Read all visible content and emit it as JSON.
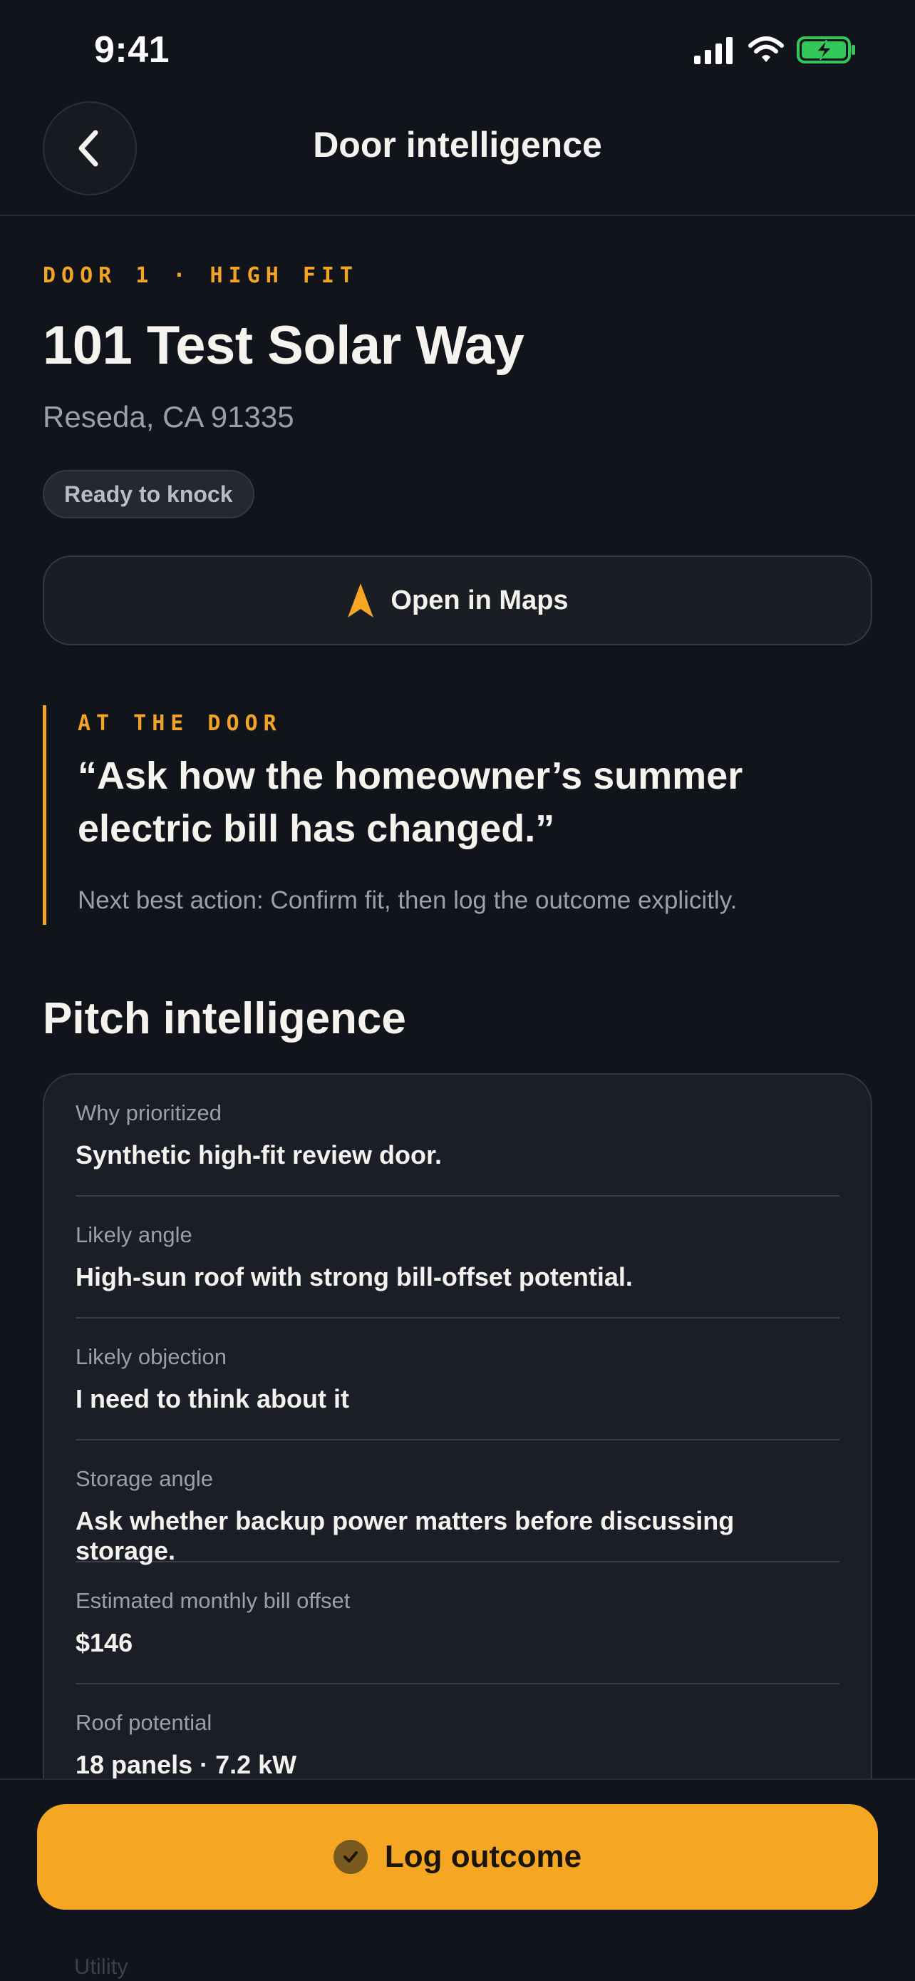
{
  "status_bar": {
    "time": "9:41",
    "icons": [
      "cellular-signal-icon",
      "wifi-icon",
      "battery-charging-icon"
    ]
  },
  "nav": {
    "title": "Door intelligence",
    "back_icon": "chevron-left-icon"
  },
  "door": {
    "eyebrow": "DOOR 1 · HIGH FIT",
    "address": "101 Test Solar Way",
    "city": "Reseda, CA 91335",
    "status": "Ready to knock"
  },
  "maps_button": {
    "label": "Open in Maps",
    "icon": "navigation-arrow-icon"
  },
  "callout": {
    "eyebrow": "AT THE DOOR",
    "quote": "“Ask how the homeowner’s summer electric bill has changed.”",
    "action": "Next best action: Confirm fit, then log the outcome explicitly."
  },
  "pitch": {
    "title": "Pitch intelligence",
    "rows": [
      {
        "label": "Why prioritized",
        "value": "Synthetic high-fit review door."
      },
      {
        "label": "Likely angle",
        "value": "High-sun roof with strong bill-offset potential."
      },
      {
        "label": "Likely objection",
        "value": "I need to think about it"
      },
      {
        "label": "Storage angle",
        "value": "Ask whether backup power matters before discussing storage."
      },
      {
        "label": "Estimated monthly bill offset",
        "value": "$146"
      },
      {
        "label": "Roof potential",
        "value": "18 panels · 7.2 kW"
      }
    ],
    "peek_label": "Utility"
  },
  "bottom": {
    "log_label": "Log outcome",
    "log_icon": "check-circle-icon"
  },
  "colors": {
    "background": "#11141b",
    "accent": "#f5a623",
    "card": "#1b1e26",
    "muted_text": "#9aa0ab",
    "battery": "#34c759"
  }
}
